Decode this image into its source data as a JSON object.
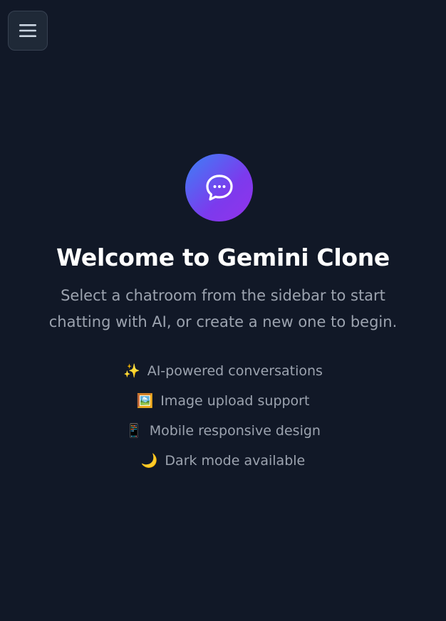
{
  "header": {
    "menu_icon": "hamburger-menu-icon"
  },
  "welcome": {
    "logo_icon": "chat-bubble-icon",
    "title": "Welcome to Gemini Clone",
    "subtitle_line1": "Select a chatroom from the sidebar to start",
    "subtitle_line2": "chatting with AI, or create a new one to begin.",
    "features": [
      {
        "icon": "✨",
        "label": "AI-powered conversations"
      },
      {
        "icon": "🖼️",
        "label": "Image upload support"
      },
      {
        "icon": "📱",
        "label": "Mobile responsive design"
      },
      {
        "icon": "🌙",
        "label": "Dark mode available"
      }
    ]
  },
  "colors": {
    "background": "#111827",
    "text_muted": "#9ca3af",
    "gradient_start": "#3b82f6",
    "gradient_end": "#9333ea"
  }
}
